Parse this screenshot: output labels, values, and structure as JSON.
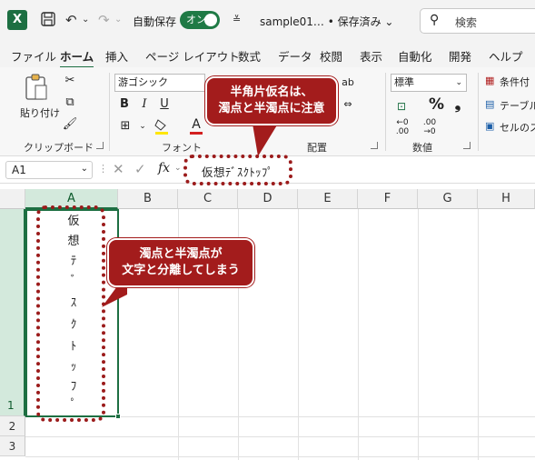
{
  "title_bar": {
    "app_logo": "X",
    "autosave_label": "自動保存",
    "autosave_toggle": "オン",
    "doc_title": "sample01… • 保存済み ⌄",
    "search_placeholder": "検索"
  },
  "menu": [
    "ファイル",
    "ホーム",
    "挿入",
    "ページ レイアウト",
    "数式",
    "データ",
    "校閲",
    "表示",
    "自動化",
    "開発",
    "ヘルプ"
  ],
  "menu_active": "ホーム",
  "ribbon": {
    "paste_label": "貼り付け",
    "clipboard_group": "クリップボード",
    "font_name": "游ゴシック",
    "font_group": "フォント",
    "bold": "B",
    "italic": "I",
    "underline": "U",
    "font_color_glyph": "A",
    "align_group": "配置",
    "number_format": "標準",
    "percent": "%",
    "comma": "❟",
    "number_group": "数値",
    "conditional_format": "条件付",
    "format_table": "テーブル",
    "cell_styles": "セルのス"
  },
  "formula_bar": {
    "name_box": "A1",
    "fx": "fx",
    "formula_value": "仮想ﾃﾞｽｸﾄｯﾌﾟ"
  },
  "columns": [
    "A",
    "B",
    "C",
    "D",
    "E",
    "F",
    "G",
    "H"
  ],
  "rows": [
    "1",
    "2",
    "3"
  ],
  "cell_a1_chars": [
    "仮",
    "想",
    "ﾃ",
    "ﾞ",
    "ｽ",
    "ｸ",
    "ﾄ",
    "ｯ",
    "ﾌ",
    "ﾟ"
  ],
  "callouts": {
    "top": [
      "半角片仮名は、",
      "濁点と半濁点に注意"
    ],
    "middle": [
      "濁点と半濁点が",
      "文字と分離してしまう"
    ]
  },
  "colors": {
    "excel_green": "#1d6f42",
    "callout_red": "#a31c1c"
  }
}
